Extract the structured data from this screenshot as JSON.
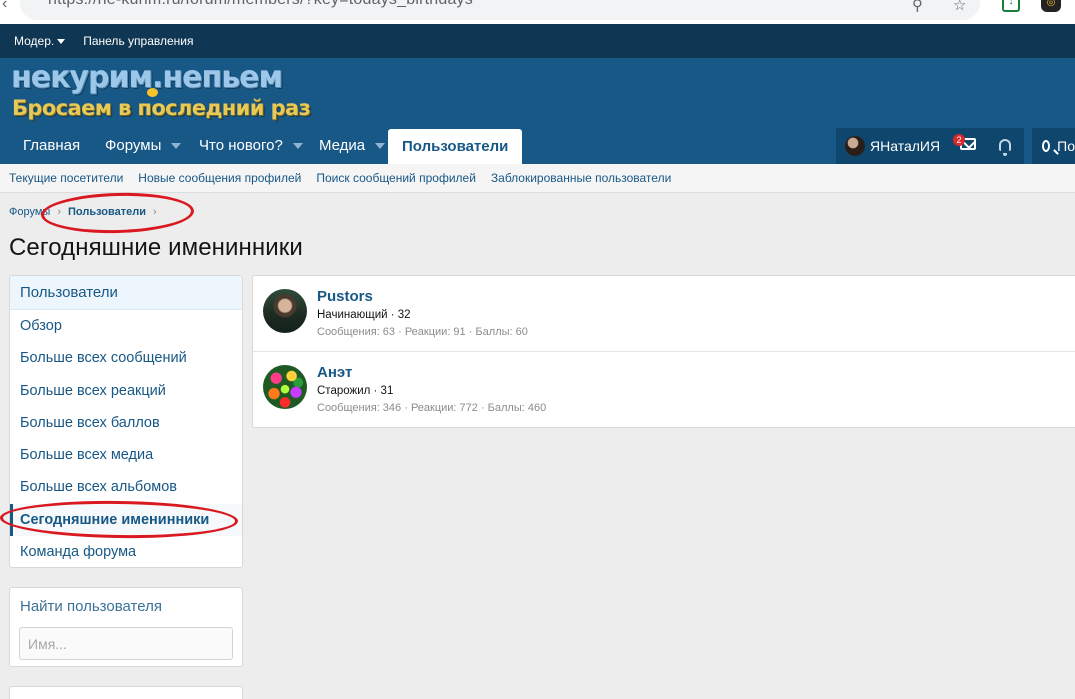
{
  "browser": {
    "url": "https://ne-kurim.ru/forum/members/?key=todays_birthdays"
  },
  "staff_bar": {
    "moderator": "Модер.",
    "control_panel": "Панель управления"
  },
  "logo": {
    "line1": "некурим.непьем",
    "line2": "Бросаем в последний раз"
  },
  "nav": {
    "home": "Главная",
    "forums": "Форумы",
    "whats_new": "Что нового?",
    "media": "Медиа",
    "members": "Пользователи",
    "username": "ЯНаталИЯ",
    "inbox_badge": "2",
    "search_label": "По"
  },
  "subnav": {
    "current_visitors": "Текущие посетители",
    "new_profile_posts": "Новые сообщения профилей",
    "search_profile_posts": "Поиск сообщений профилей",
    "banned_users": "Заблокированные пользователи"
  },
  "breadcrumb": {
    "forums": "Форумы",
    "members": "Пользователи"
  },
  "page_title": "Сегодняшние именинники",
  "sidebar": {
    "header": "Пользователи",
    "items": [
      {
        "label": "Обзор"
      },
      {
        "label": "Больше всех сообщений"
      },
      {
        "label": "Больше всех реакций"
      },
      {
        "label": "Больше всех баллов"
      },
      {
        "label": "Больше всех медиа"
      },
      {
        "label": "Больше всех альбомов"
      },
      {
        "label": "Сегодняшние именинники"
      },
      {
        "label": "Команда форума"
      }
    ]
  },
  "find_member": {
    "title": "Найти пользователя",
    "placeholder": "Имя..."
  },
  "members": [
    {
      "name": "Pustors",
      "title": "Начинающий · 32",
      "stats": "Сообщения: 63 · Реакции: 91 · Баллы: 60"
    },
    {
      "name": "Анэт",
      "title": "Старожил · 31",
      "stats": "Сообщения: 346 · Реакции: 772 · Баллы: 460"
    }
  ]
}
